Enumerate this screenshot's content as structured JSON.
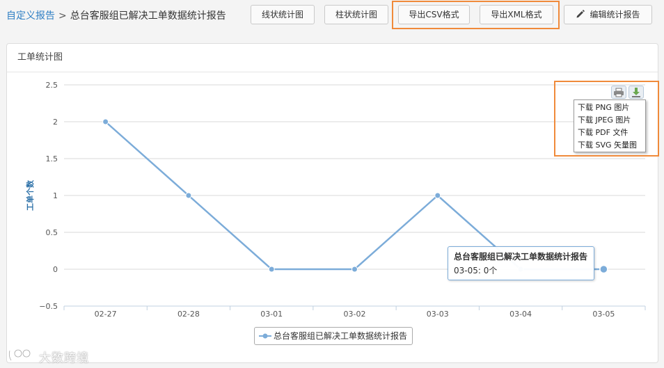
{
  "breadcrumb": {
    "link": "自定义报告",
    "separator": ">",
    "title": "总台客服组已解决工单数据统计报告"
  },
  "toolbar": {
    "line_chart": "线状统计图",
    "bar_chart": "柱状统计图",
    "export_csv": "导出CSV格式",
    "export_xml": "导出XML格式",
    "edit_report": "编辑统计报告"
  },
  "panel": {
    "title": "工单统计图"
  },
  "chart_data": {
    "type": "line",
    "title": "",
    "xlabel": "",
    "ylabel": "工单个数",
    "categories": [
      "02-27",
      "02-28",
      "03-01",
      "03-02",
      "03-03",
      "03-04",
      "03-05"
    ],
    "series": [
      {
        "name": "总台客服组已解决工单数据统计报告",
        "values": [
          2,
          1,
          0,
          0,
          1,
          0,
          0
        ]
      }
    ],
    "ylim": [
      -0.5,
      2.5
    ],
    "yticks": [
      -0.5,
      0,
      0.5,
      1,
      1.5,
      2,
      2.5
    ],
    "ytick_labels": [
      "−0.5",
      "0",
      "0.5",
      "1",
      "1.5",
      "2",
      "2.5"
    ],
    "grid": true,
    "legend": "bottom-center",
    "highlighted_index": 6,
    "color": "#7cacd9"
  },
  "export_menu": {
    "items": [
      "下载 PNG 图片",
      "下载 JPEG 图片",
      "下载 PDF 文件",
      "下载 SVG 矢量图"
    ]
  },
  "tooltip": {
    "title": "总台客服组已解决工单数据统计报告",
    "body": "03-05: 0个"
  },
  "watermark": {
    "text": "大数跨境"
  },
  "colors": {
    "accent": "#2f7fc4",
    "highlight": "#f08a3a",
    "series": "#7cacd9"
  }
}
